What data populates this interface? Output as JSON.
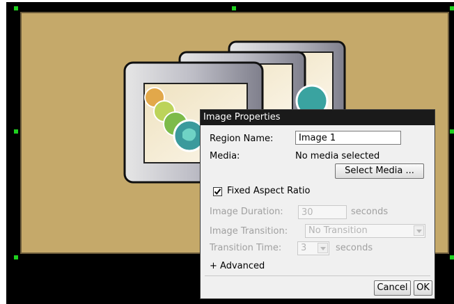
{
  "dialog": {
    "title": "Image Properties",
    "region_name_label": "Region Name:",
    "region_name_value": "Image 1",
    "media_label": "Media:",
    "media_value": "No media selected",
    "select_media_label": "Select Media ...",
    "fixed_aspect_label": "Fixed Aspect Ratio",
    "fixed_aspect_checked": true,
    "image_duration_label": "Image Duration:",
    "image_duration_value": "30",
    "seconds_label": "seconds",
    "image_transition_label": "Image Transition:",
    "image_transition_value": "No Transition",
    "transition_time_label": "Transition Time:",
    "transition_time_value": "3",
    "transition_seconds_label": "seconds",
    "advanced_label": "+ Advanced",
    "cancel_label": "Cancel",
    "ok_label": "OK"
  },
  "colors": {
    "region_fill": "#c5a96a",
    "canvas": "#000000",
    "handle": "#1fd11f",
    "title_bar": "#1a1a1a"
  },
  "icons": {
    "illustration": "stacked-image-frames-illustration",
    "checkbox": "checkmark-icon",
    "dropdown": "chevron-down-icon"
  }
}
